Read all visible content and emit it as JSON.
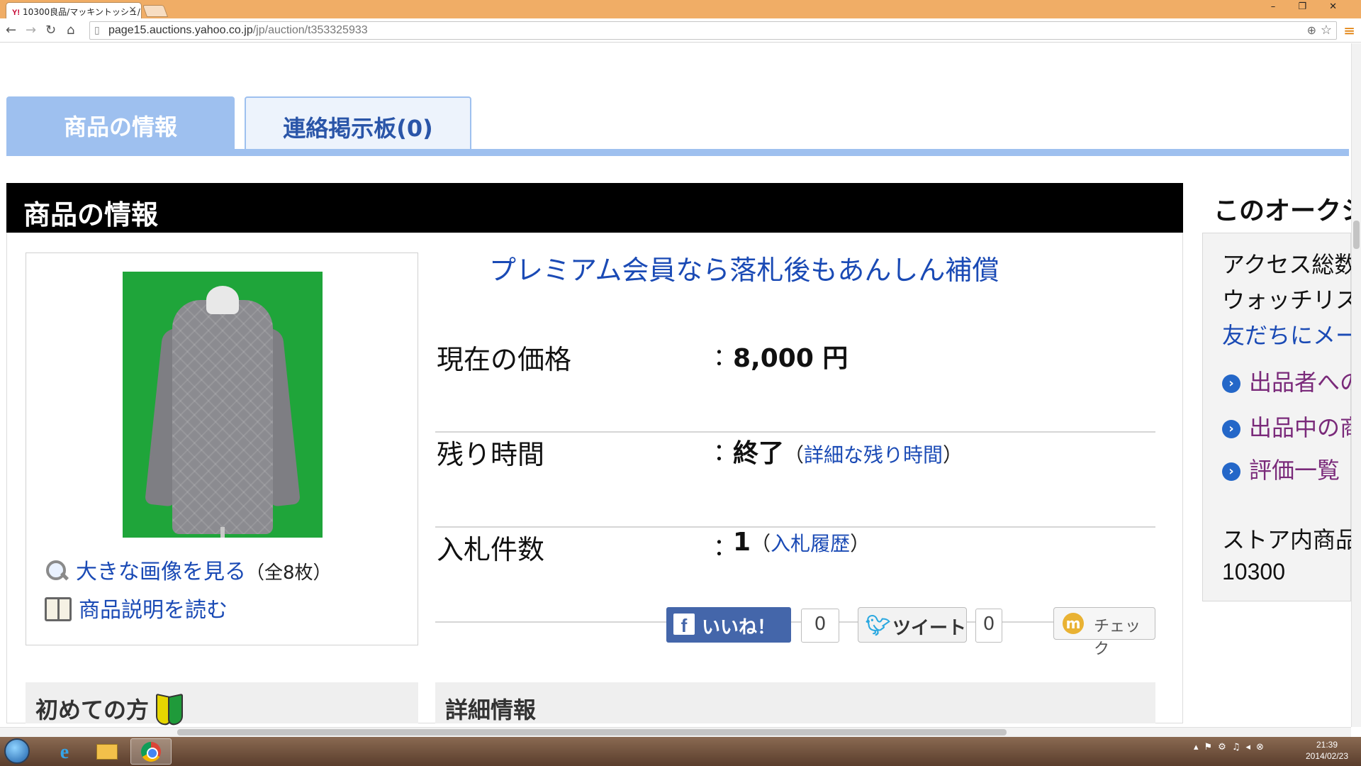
{
  "browser": {
    "tab_title": "10300良品/マッキントッシュ/",
    "tab_favicon": "Y!",
    "url_host": "page15.auctions.yahoo.co.jp",
    "url_path": "/jp/auction/t353325933",
    "window_controls": "– ❐ ✕"
  },
  "page_tabs": {
    "item_info": "商品の情報",
    "message_board": "連絡掲示板(0)"
  },
  "section": {
    "header": "商品の情報"
  },
  "image_box": {
    "view_large": "大きな画像を見る",
    "view_large_count": "（全8枚）",
    "read_description": "商品説明を読む"
  },
  "premium_link": "プレミアム会員なら落札後もあんしん補償",
  "details": {
    "price_label": "現在の価格",
    "price_value": "8,000 円",
    "time_label": "残り時間",
    "time_value": "終了",
    "time_link": "詳細な残り時間",
    "bids_label": "入札件数",
    "bids_value": "1",
    "bids_link": "入札履歴",
    "colon": "："
  },
  "social": {
    "facebook_label": "いいね！",
    "facebook_count": "0",
    "twitter_label": "ツイート",
    "twitter_count": "0",
    "mixi_label": "チェック"
  },
  "bottom": {
    "first_time": "初めての方",
    "detail_info": "詳細情報"
  },
  "sidebar": {
    "title": "このオークシ",
    "access": "アクセス総数",
    "watchlist": "ウォッチリスト",
    "friend_mail": "友だちにメー",
    "link_seller_q": "出品者への",
    "link_seller_items": "出品中の商",
    "link_ratings": "評価一覧",
    "store_items": "ストア内商品",
    "store_count": "10300"
  },
  "clock": {
    "time": "21:39",
    "date": "2014/02/23"
  },
  "colors": {
    "tab_blue": "#9ec0ef",
    "link_blue": "#1a4ab5",
    "visited_purple": "#7a2a7a",
    "chrome_orange": "#f0ad66"
  }
}
